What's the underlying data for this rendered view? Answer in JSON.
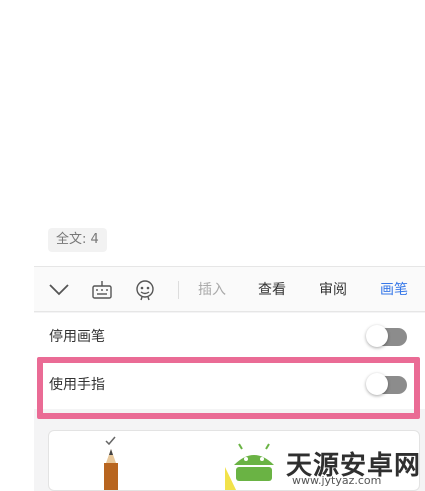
{
  "status": {
    "word_count": "全文: 4"
  },
  "toolbar": {
    "icons": [
      "collapse-chevron",
      "keyboard",
      "voice-assistant"
    ],
    "tabs": [
      {
        "label": "插入",
        "state": "disabled"
      },
      {
        "label": "查看",
        "state": "normal"
      },
      {
        "label": "审阅",
        "state": "normal"
      },
      {
        "label": "画笔",
        "state": "active"
      }
    ]
  },
  "settings": {
    "disable_pen": {
      "label": "停用画笔",
      "on": false
    },
    "use_finger": {
      "label": "使用手指",
      "on": false
    }
  },
  "pen_tools": {
    "selected_tool": "pencil"
  },
  "watermark": {
    "brand": "天源安卓网",
    "url": "www.jytyaz.com"
  },
  "colors": {
    "accent": "#3778e8",
    "highlight_box": "#ea6b95",
    "toggle_off": "#8c8c8c"
  }
}
